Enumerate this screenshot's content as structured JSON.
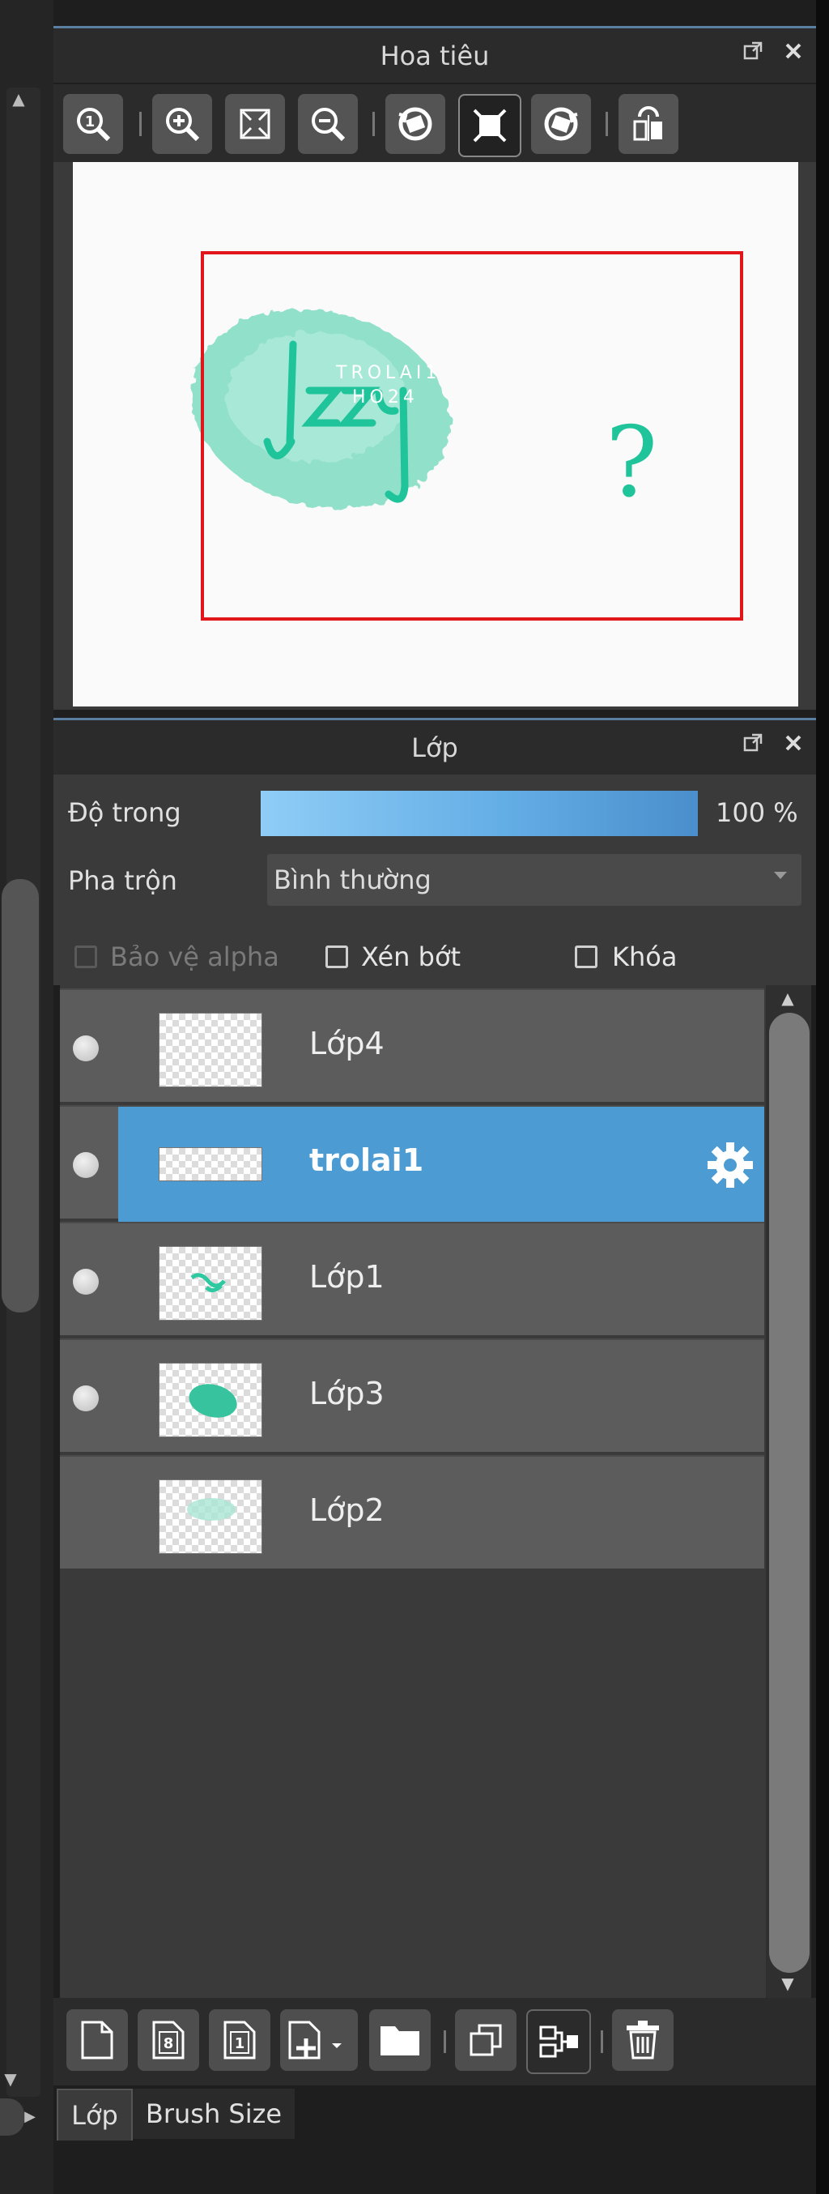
{
  "navigator": {
    "title": "Hoa tiêu",
    "toolbar": [
      {
        "icon": "zoom-actual-icon"
      },
      {
        "icon": "zoom-in-icon"
      },
      {
        "icon": "fit-screen-icon"
      },
      {
        "icon": "zoom-out-icon"
      },
      {
        "icon": "rotate-left-icon"
      },
      {
        "icon": "reset-view-icon"
      },
      {
        "icon": "rotate-right-icon"
      },
      {
        "icon": "flip-horizontal-icon"
      }
    ],
    "preview_text": "TROLAI1 HO24"
  },
  "layers_panel": {
    "title": "Lớp",
    "opacity_label": "Độ trong",
    "opacity_value": "100 %",
    "opacity_fraction": 1.0,
    "blend_label": "Pha trộn",
    "blend_value": "Bình thường",
    "protect_alpha_label": "Bảo vệ alpha",
    "clipping_label": "Xén bớt",
    "lock_label": "Khóa",
    "layers": [
      {
        "name": "Lớp4",
        "visible": true,
        "selected": false
      },
      {
        "name": "trolai1",
        "visible": true,
        "selected": true
      },
      {
        "name": "Lớp1",
        "visible": true,
        "selected": false
      },
      {
        "name": "Lớp3",
        "visible": true,
        "selected": false
      },
      {
        "name": "Lớp2",
        "visible": false,
        "selected": false
      }
    ],
    "bottom_toolbar": [
      {
        "icon": "new-layer-icon"
      },
      {
        "icon": "new-8bit-layer-icon"
      },
      {
        "icon": "new-1bit-layer-icon"
      },
      {
        "icon": "add-layer-menu-icon"
      },
      {
        "icon": "new-folder-icon"
      },
      {
        "icon": "duplicate-layer-icon"
      },
      {
        "icon": "merge-down-icon"
      },
      {
        "icon": "delete-layer-icon"
      }
    ]
  },
  "tabs": [
    {
      "label": "Lớp",
      "active": true
    },
    {
      "label": "Brush Size",
      "active": false
    }
  ],
  "colors": {
    "selection": "#4d9bd3",
    "navigator_frame": "#e0161a",
    "artwork": "#2ec9a0"
  }
}
